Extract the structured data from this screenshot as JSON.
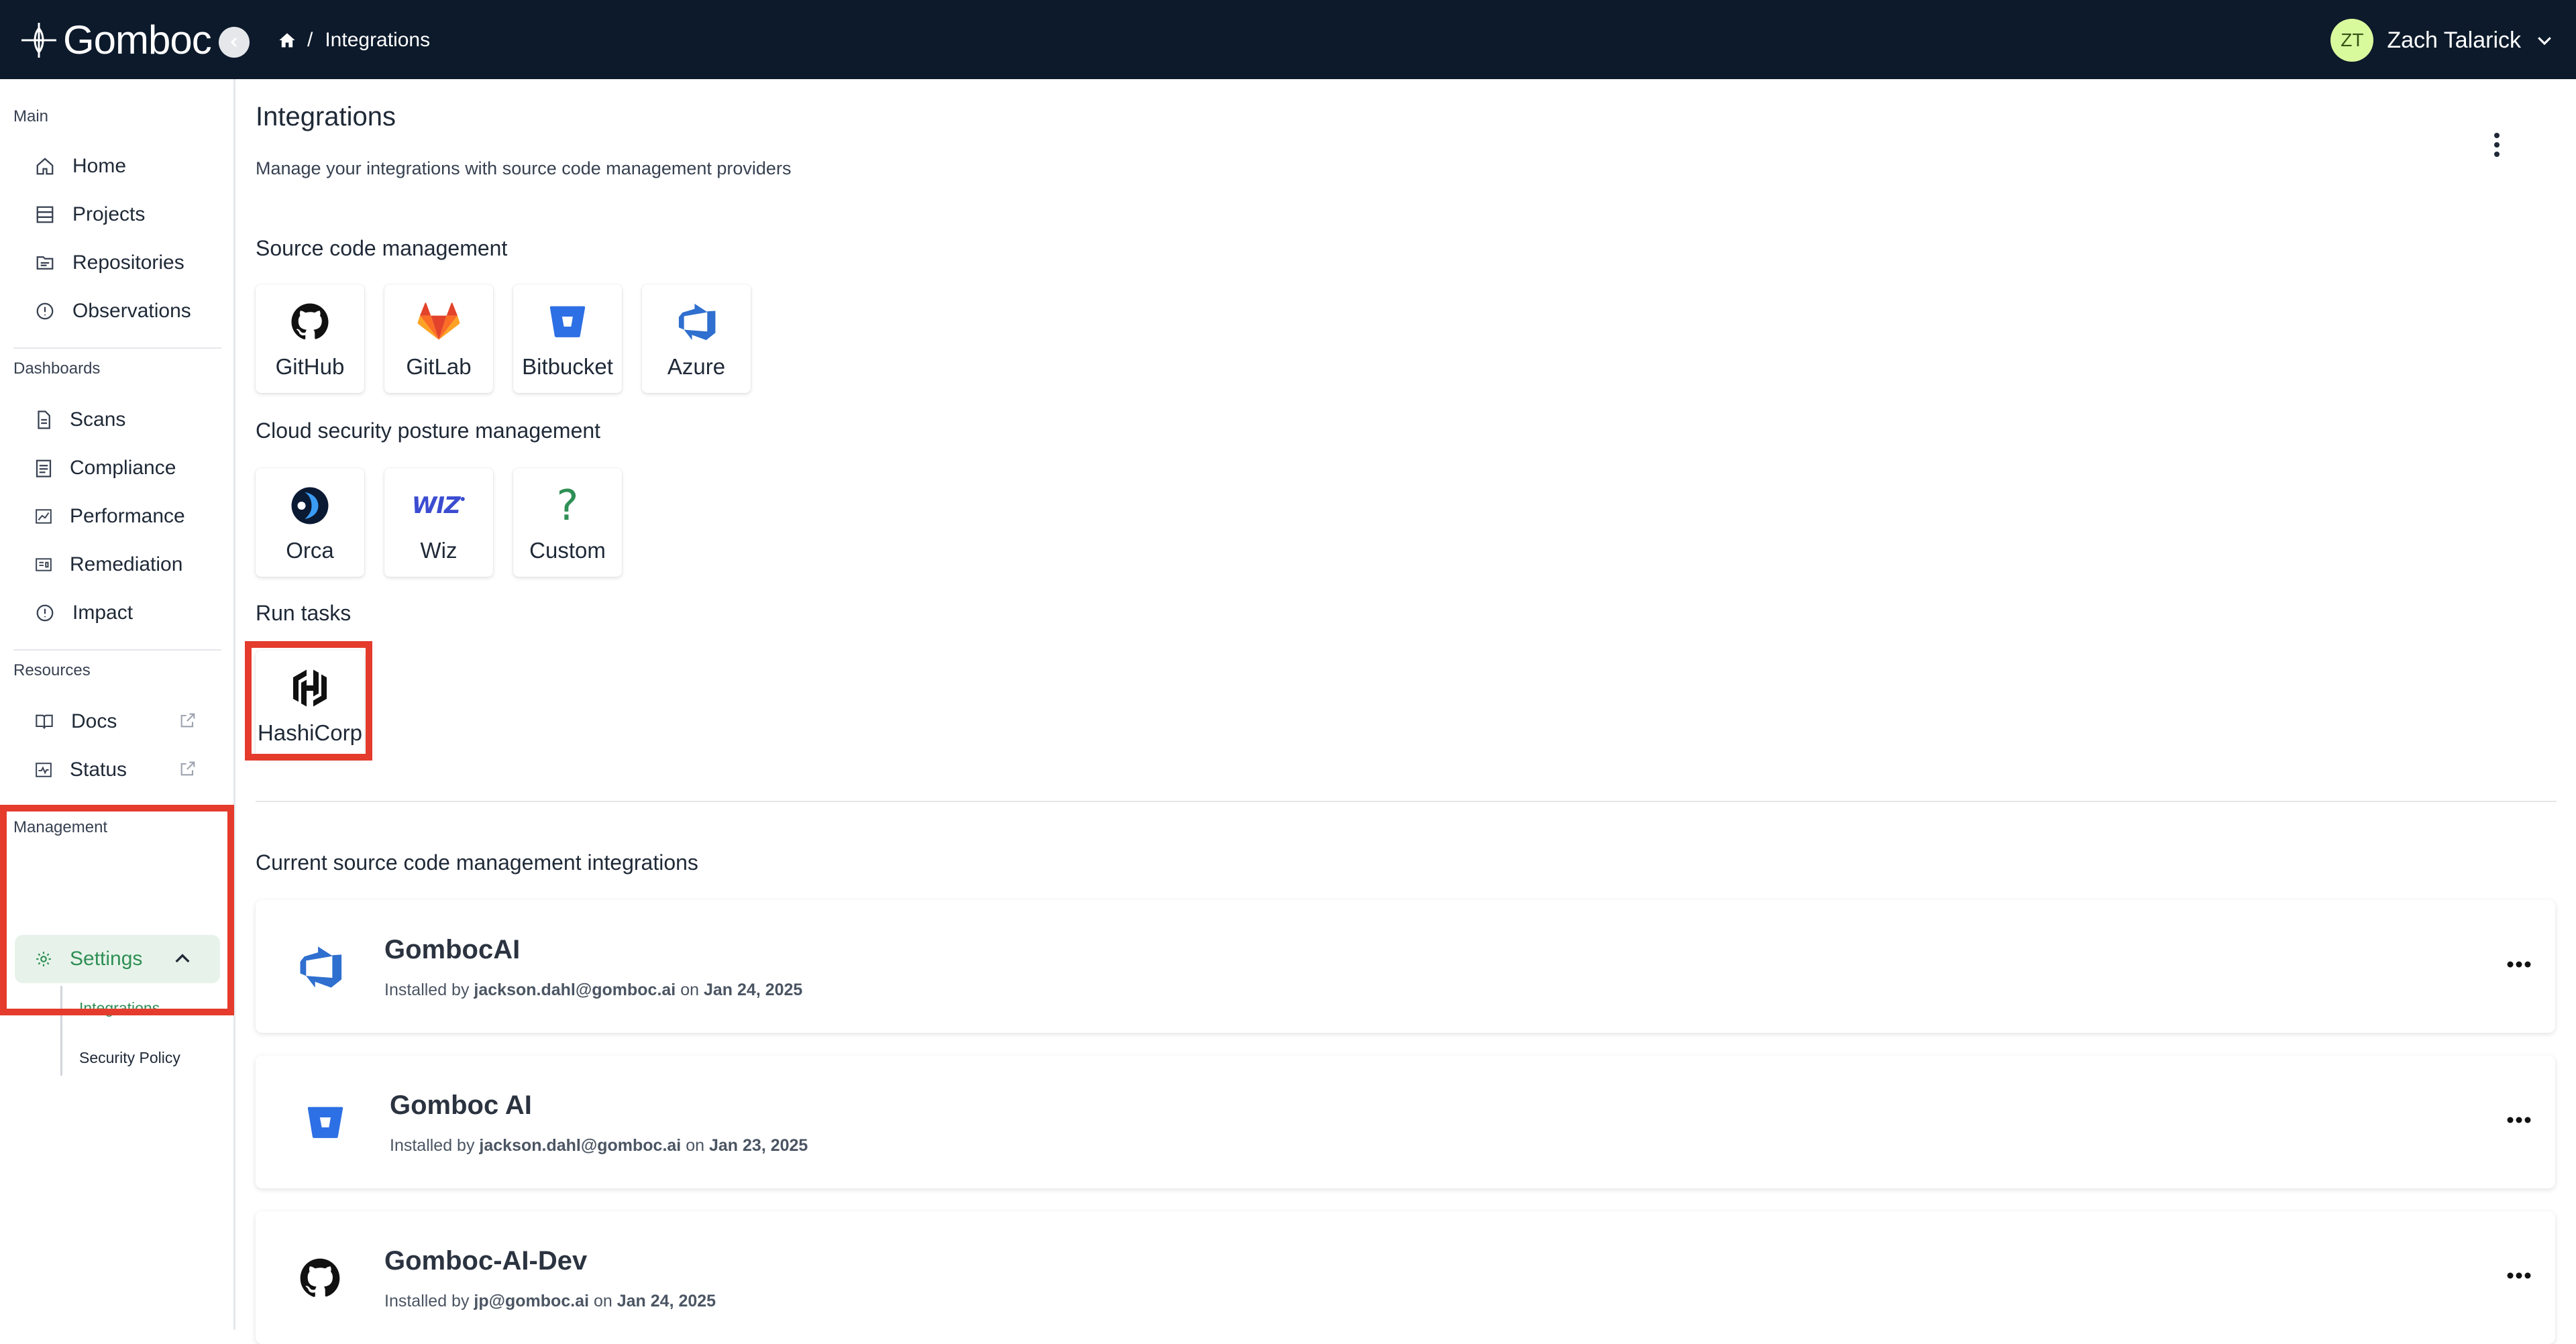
{
  "topbar": {
    "brand": "Gomboc",
    "breadcrumb": {
      "home_icon": "home-icon",
      "separator": "/",
      "current": "Integrations"
    },
    "user": {
      "initials": "ZT",
      "name": "Zach Talarick"
    }
  },
  "sidebar": {
    "sections": {
      "main": "Main",
      "dashboards": "Dashboards",
      "resources": "Resources",
      "management": "Management"
    },
    "main_items": [
      {
        "label": "Home",
        "icon": "home-icon"
      },
      {
        "label": "Projects",
        "icon": "projects-icon"
      },
      {
        "label": "Repositories",
        "icon": "folder-icon"
      },
      {
        "label": "Observations",
        "icon": "alert-circle-icon"
      }
    ],
    "dashboard_items": [
      {
        "label": "Scans",
        "icon": "scan-icon"
      },
      {
        "label": "Compliance",
        "icon": "checklist-icon"
      },
      {
        "label": "Performance",
        "icon": "chart-icon"
      },
      {
        "label": "Remediation",
        "icon": "remediation-icon"
      },
      {
        "label": "Impact",
        "icon": "alert-circle-icon"
      }
    ],
    "resource_items": [
      {
        "label": "Docs",
        "icon": "book-icon"
      },
      {
        "label": "Status",
        "icon": "status-icon"
      }
    ],
    "settings": {
      "label": "Settings",
      "sub_items": [
        {
          "label": "Integrations"
        },
        {
          "label": "Security Policy"
        }
      ]
    }
  },
  "main": {
    "title": "Integrations",
    "subtitle": "Manage your integrations with source code management providers",
    "scm_heading": "Source code management",
    "scm_tiles": [
      {
        "label": "GitHub",
        "icon": "github-icon"
      },
      {
        "label": "GitLab",
        "icon": "gitlab-icon"
      },
      {
        "label": "Bitbucket",
        "icon": "bitbucket-icon"
      },
      {
        "label": "Azure",
        "icon": "azure-devops-icon"
      }
    ],
    "cspm_heading": "Cloud security posture management",
    "cspm_tiles": [
      {
        "label": "Orca",
        "icon": "orca-icon"
      },
      {
        "label": "Wiz",
        "icon": "wiz-icon",
        "logo_text": "WIZ"
      },
      {
        "label": "Custom",
        "icon": "question-icon",
        "glyph": "?"
      }
    ],
    "run_heading": "Run tasks",
    "run_tiles": [
      {
        "label": "HashiCorp",
        "icon": "hashicorp-icon"
      }
    ],
    "current_heading": "Current source code management integrations",
    "integrations": [
      {
        "name": "GombocAI",
        "installed_by_prefix": "Installed by",
        "user": "jackson.dahl@gomboc.ai",
        "on_word": "on",
        "date": "Jan 24, 2025",
        "icon": "azure-devops-icon"
      },
      {
        "name": "Gomboc AI",
        "installed_by_prefix": "Installed by",
        "user": "jackson.dahl@gomboc.ai",
        "on_word": "on",
        "date": "Jan 23, 2025",
        "icon": "bitbucket-icon"
      },
      {
        "name": "Gomboc-AI-Dev",
        "installed_by_prefix": "Installed by",
        "user": "jp@gomboc.ai",
        "on_word": "on",
        "date": "Jan 24, 2025",
        "icon": "github-icon"
      }
    ]
  },
  "colors": {
    "topbar": "#0c1a2b",
    "accent_green": "#2f8f55",
    "highlight_red": "#e43b2c",
    "azure_blue": "#2f6fcf",
    "bitbucket_blue": "#2d6fe4",
    "gitlab_orange": "#e2582b",
    "question_green": "#2f8f55"
  }
}
